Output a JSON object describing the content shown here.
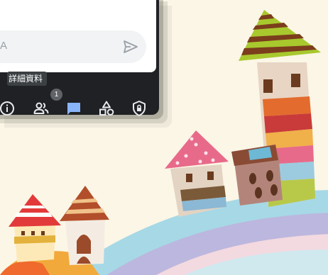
{
  "chat": {
    "input_placeholder": "A",
    "send_icon": "send-icon"
  },
  "tooltip": {
    "text": "詳細資料"
  },
  "toolbar": {
    "items": [
      {
        "icon": "info-icon",
        "label": "詳細資料"
      },
      {
        "icon": "people-icon",
        "badge": "1"
      },
      {
        "icon": "chat-icon",
        "active": true
      },
      {
        "icon": "activities-icon"
      },
      {
        "icon": "host-controls-icon"
      }
    ],
    "active_color": "#8ab4f8",
    "icon_color": "#e8eaed"
  },
  "wallpaper": {
    "description_colors": [
      "#fbf6e6",
      "#a8cc2e",
      "#e2622c",
      "#e86a8a",
      "#a9d8e4"
    ]
  }
}
